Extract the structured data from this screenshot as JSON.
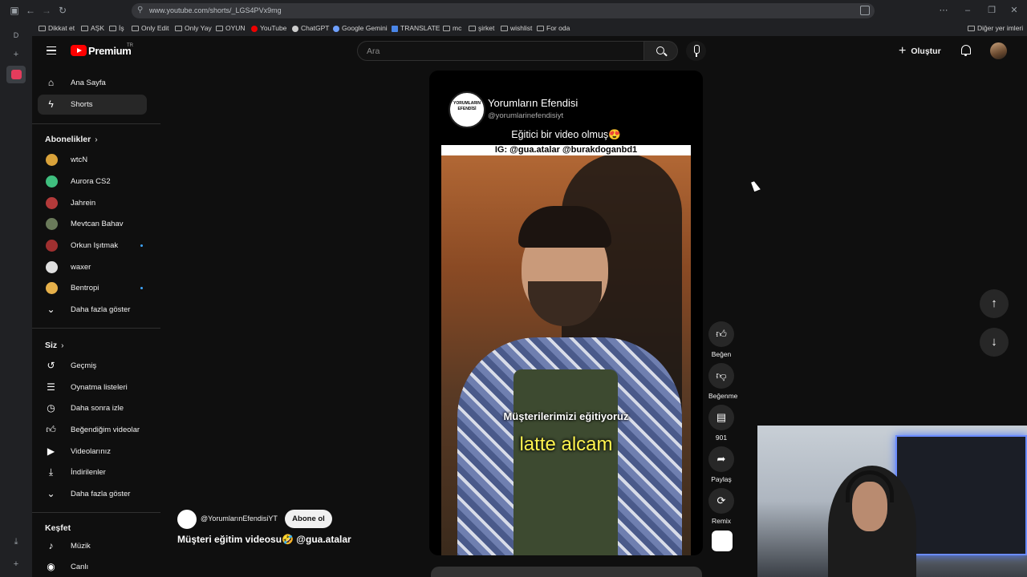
{
  "browser": {
    "url": "www.youtube.com/shorts/_LGS4PVx9mg",
    "bookmarks": [
      {
        "label": "Dikkat et",
        "icon": "folder-icon"
      },
      {
        "label": "AŞK",
        "icon": "folder-icon"
      },
      {
        "label": "İş",
        "icon": "folder-icon"
      },
      {
        "label": "Only Edit",
        "icon": "folder-icon"
      },
      {
        "label": "Only Yay",
        "icon": "folder-icon"
      },
      {
        "label": "OYUN",
        "icon": "folder-icon"
      },
      {
        "label": "YouTube",
        "icon": "youtube-icon"
      },
      {
        "label": "ChatGPT",
        "icon": "chatgpt-icon"
      },
      {
        "label": "Google Gemini",
        "icon": "gemini-icon"
      },
      {
        "label": "TRANSLATE",
        "icon": "translate-icon"
      },
      {
        "label": "mc",
        "icon": "folder-icon"
      },
      {
        "label": "şirket",
        "icon": "folder-icon"
      },
      {
        "label": "wishlist",
        "icon": "folder-icon"
      },
      {
        "label": "For oda",
        "icon": "folder-icon"
      }
    ],
    "other_bookmarks": "Diğer yer imleri"
  },
  "header": {
    "logo": "Premium",
    "logo_country": "TR",
    "search_placeholder": "Ara",
    "create_label": "Oluştur"
  },
  "sidebar": {
    "main": [
      {
        "label": "Ana Sayfa",
        "icon": "home-icon"
      },
      {
        "label": "Shorts",
        "icon": "shorts-icon"
      }
    ],
    "subscriptions_title": "Abonelikler",
    "subscriptions": [
      {
        "label": "wtcN",
        "color": "#d9a23a",
        "new": false
      },
      {
        "label": "Aurora CS2",
        "color": "#3fbf7f",
        "new": false
      },
      {
        "label": "Jahrein",
        "color": "#b33a3a",
        "new": false
      },
      {
        "label": "Mevtcan Bahav",
        "color": "#6a7a5a",
        "new": false
      },
      {
        "label": "Orkun Işıtmak",
        "color": "#a03030",
        "new": true
      },
      {
        "label": "waxer",
        "color": "#e0e0e0",
        "new": false
      },
      {
        "label": "Bentropi",
        "color": "#e6b04a",
        "new": true
      }
    ],
    "show_more_1": "Daha fazla göster",
    "you_title": "Siz",
    "you": [
      {
        "label": "Geçmiş",
        "icon": "history-icon"
      },
      {
        "label": "Oynatma listeleri",
        "icon": "playlist-icon"
      },
      {
        "label": "Daha sonra izle",
        "icon": "watch-later-icon"
      },
      {
        "label": "Beğendiğim videolar",
        "icon": "like-icon"
      },
      {
        "label": "Videolarınız",
        "icon": "your-videos-icon"
      },
      {
        "label": "İndirilenler",
        "icon": "download-icon"
      }
    ],
    "show_more_2": "Daha fazla göster",
    "explore_title": "Keşfet",
    "explore": [
      {
        "label": "Müzik",
        "icon": "music-icon"
      },
      {
        "label": "Canlı",
        "icon": "live-icon"
      }
    ]
  },
  "short": {
    "channel_name": "Yorumların Efendisi",
    "channel_handle": "@yorumlarinefendisiyt",
    "logo_text": "YORUMLARIN EFENDİSİ",
    "caption_top": "Eğitici bir video olmuş😍",
    "caption_ig": "IG: @gua.atalar @burakdoganbd1",
    "video_text_1": "Müşterilerimizi eğitiyoruz",
    "video_text_2": "latte alcam",
    "meta_channel": "@YorumlarınEfendisiYT",
    "subscribe_label": "Abone ol",
    "title": "Müşteri eğitim videosu🤣 @gua.atalar"
  },
  "actions": [
    {
      "label": "Beğen",
      "icon": "thumbs-up-icon"
    },
    {
      "label": "Beğenme",
      "icon": "thumbs-down-icon"
    },
    {
      "label": "901",
      "icon": "comment-icon"
    },
    {
      "label": "Paylaş",
      "icon": "share-icon"
    },
    {
      "label": "Remix",
      "icon": "remix-icon"
    }
  ]
}
